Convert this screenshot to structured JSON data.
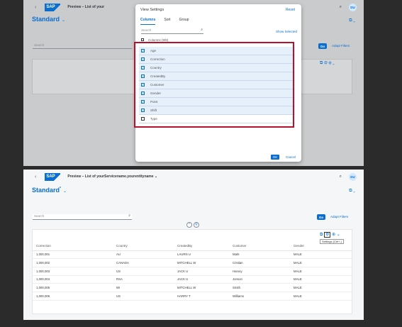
{
  "top": {
    "shell": {
      "title": "Preview – List of your",
      "avatar": "DU"
    },
    "variant": "Standard",
    "search_placeholder": "Search",
    "go_label": "Go",
    "adapt_filters": "Adapt Filters",
    "dialog": {
      "title": "View Settings",
      "reset": "Reset",
      "tabs": [
        "Columns",
        "Sort",
        "Group"
      ],
      "search_placeholder": "Search",
      "show_selected": "Show Selected",
      "columns_header": "Columns (8/8)",
      "columns": [
        {
          "label": "Age",
          "checked": true
        },
        {
          "label": "Correction",
          "checked": true
        },
        {
          "label": "Country",
          "checked": true
        },
        {
          "label": "CreatedBy",
          "checked": true
        },
        {
          "label": "Customer",
          "checked": true
        },
        {
          "label": "Gender",
          "checked": true
        },
        {
          "label": "Point",
          "checked": true
        },
        {
          "label": "Shift",
          "checked": true
        },
        {
          "label": "Type",
          "checked": false
        }
      ],
      "ok": "OK",
      "cancel": "Cancel"
    }
  },
  "bottom": {
    "shell": {
      "title": "Preview – List of yourServicename.yourentityname",
      "avatar": "DU"
    },
    "variant": "Standard",
    "variant_mark": "*",
    "search_placeholder": "Search",
    "go_label": "Go",
    "adapt_filters": "Adapt Filters",
    "tooltip": "Settings (Ctrl+,)",
    "table": {
      "columns": [
        "Correction",
        "Country",
        "CreatedBy",
        "Customer",
        "Gender"
      ],
      "rows": [
        [
          "1,000,001",
          "AU",
          "LAURN U",
          "Mark",
          "MALE"
        ],
        [
          "1,000,002",
          "CANADA",
          "MITCHELL W",
          "Cristian",
          "MALE"
        ],
        [
          "1,000,003",
          "US",
          "JACK U",
          "Harvey",
          "MALE"
        ],
        [
          "1,000,004",
          "RSA",
          "JACK U",
          "Jonson",
          "MALE"
        ],
        [
          "1,000,005",
          "WI",
          "MITCHELL W",
          "Smith",
          "MALE"
        ],
        [
          "1,000,006",
          "US",
          "HARRY T",
          "Williams",
          "MALE"
        ]
      ]
    }
  },
  "colors": {
    "accent": "#0a6ed1",
    "highlight": "#b5122d"
  }
}
